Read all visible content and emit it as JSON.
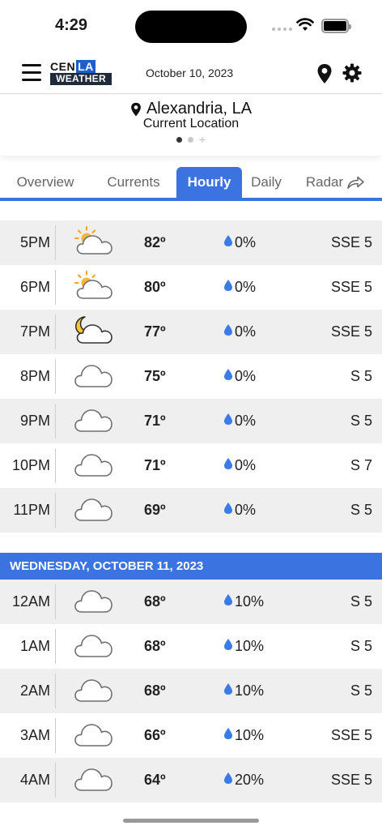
{
  "status_bar": {
    "time": "4:29"
  },
  "header": {
    "logo_top_a": "CEN",
    "logo_top_b": "LA",
    "logo_bottom": "WEATHER",
    "date": "October 10, 2023"
  },
  "location": {
    "name": "Alexandria, LA",
    "subtitle": "Current Location"
  },
  "tabs": [
    {
      "label": "Overview"
    },
    {
      "label": "Currents"
    },
    {
      "label": "Hourly"
    },
    {
      "label": "Daily"
    },
    {
      "label": "Radar"
    }
  ],
  "active_tab": "Hourly",
  "accent_color": "#3b74e0",
  "today_rows": [
    {
      "time": "5PM",
      "icon": "partly-sunny-icon",
      "temp": "82º",
      "precip": "0%",
      "wind": "SSE 5"
    },
    {
      "time": "6PM",
      "icon": "partly-sunny-icon",
      "temp": "80º",
      "precip": "0%",
      "wind": "SSE 5"
    },
    {
      "time": "7PM",
      "icon": "partly-cloudy-night-icon",
      "temp": "77º",
      "precip": "0%",
      "wind": "SSE 5"
    },
    {
      "time": "8PM",
      "icon": "cloud-icon",
      "temp": "75º",
      "precip": "0%",
      "wind": "S 5"
    },
    {
      "time": "9PM",
      "icon": "cloud-icon",
      "temp": "71º",
      "precip": "0%",
      "wind": "S 5"
    },
    {
      "time": "10PM",
      "icon": "cloud-icon",
      "temp": "71º",
      "precip": "0%",
      "wind": "S 7"
    },
    {
      "time": "11PM",
      "icon": "cloud-icon",
      "temp": "69º",
      "precip": "0%",
      "wind": "S 5"
    }
  ],
  "day_header": "WEDNESDAY, OCTOBER 11, 2023",
  "tomorrow_rows": [
    {
      "time": "12AM",
      "icon": "cloud-icon",
      "temp": "68º",
      "precip": "10%",
      "wind": "S 5"
    },
    {
      "time": "1AM",
      "icon": "cloud-icon",
      "temp": "68º",
      "precip": "10%",
      "wind": "S 5"
    },
    {
      "time": "2AM",
      "icon": "cloud-icon",
      "temp": "68º",
      "precip": "10%",
      "wind": "S 5"
    },
    {
      "time": "3AM",
      "icon": "cloud-icon",
      "temp": "66º",
      "precip": "10%",
      "wind": "SSE 5"
    },
    {
      "time": "4AM",
      "icon": "cloud-icon",
      "temp": "64º",
      "precip": "20%",
      "wind": "SSE 5"
    }
  ]
}
